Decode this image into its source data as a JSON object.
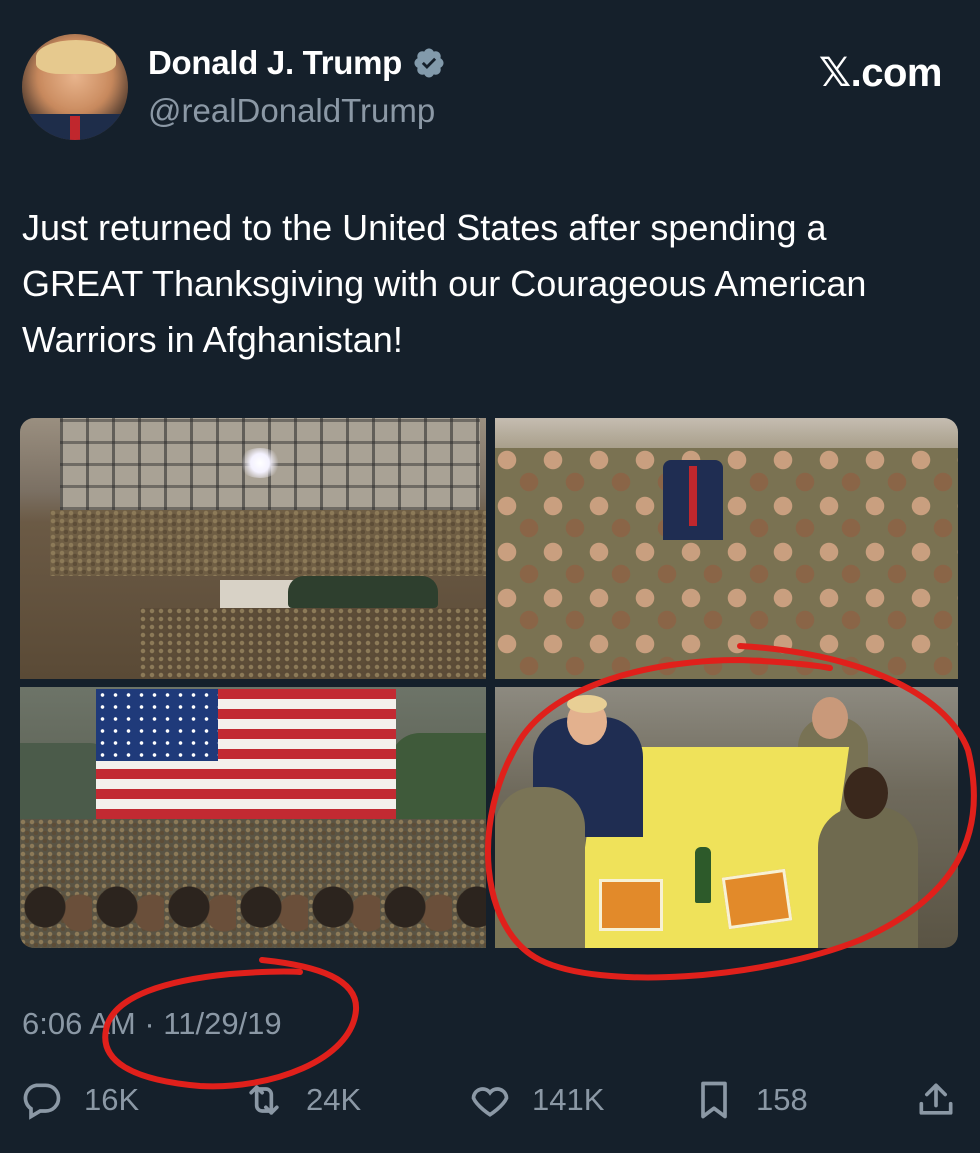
{
  "author": {
    "display_name": "Donald J. Trump",
    "handle": "@realDonaldTrump",
    "verified": true
  },
  "brand": "𝕏.com",
  "tweet": {
    "text": "Just returned to the United States after spending a GREAT Thanksgiving with our Courageous American Warriors in Afghanistan!",
    "timestamp": "6:06 AM · 11/29/19"
  },
  "media": {
    "count": 4
  },
  "actions": {
    "replies": "16K",
    "retweets": "24K",
    "likes": "141K",
    "bookmarks": "158"
  },
  "colors": {
    "background": "#15202b",
    "muted_text": "#8b98a5",
    "verified_badge": "#829aab",
    "annotation_red": "#e0201b"
  }
}
